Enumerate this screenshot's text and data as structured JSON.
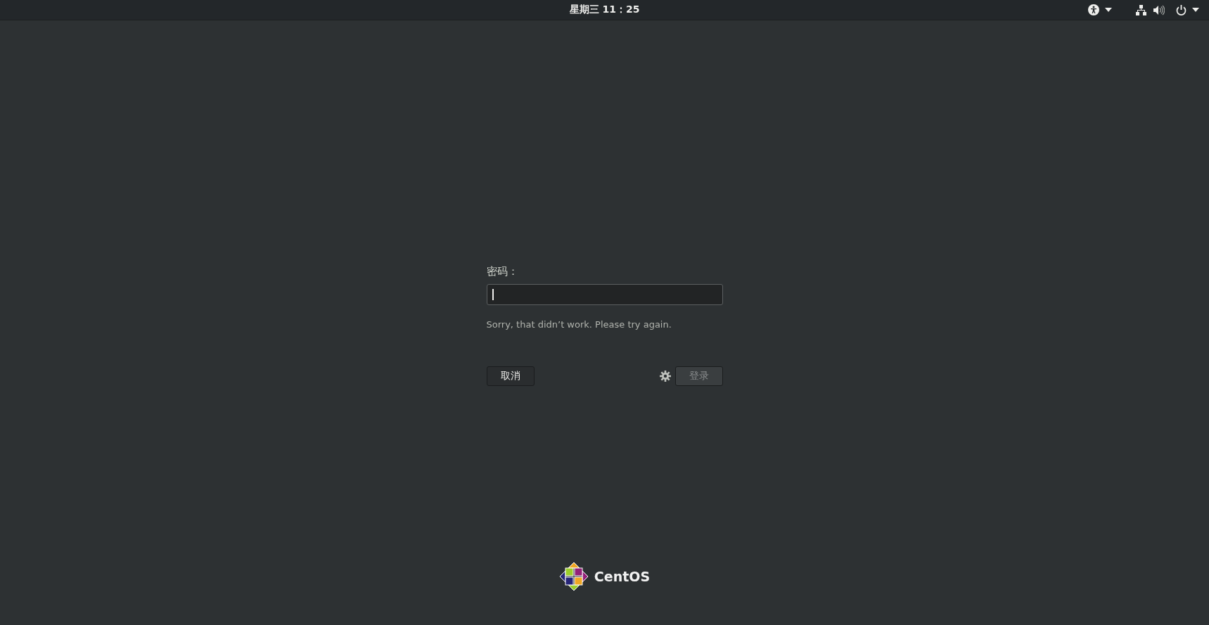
{
  "top_bar": {
    "clock": "星期三 11：25"
  },
  "login": {
    "label": "密码：",
    "password_field": {
      "focused": true
    },
    "message": "Sorry, that didn’t work. Please try again.",
    "cancel_button": {
      "label": "取消"
    },
    "sign_in_button": {
      "label": "登录",
      "disabled": true
    }
  },
  "brand": {
    "name": "CentOS"
  }
}
